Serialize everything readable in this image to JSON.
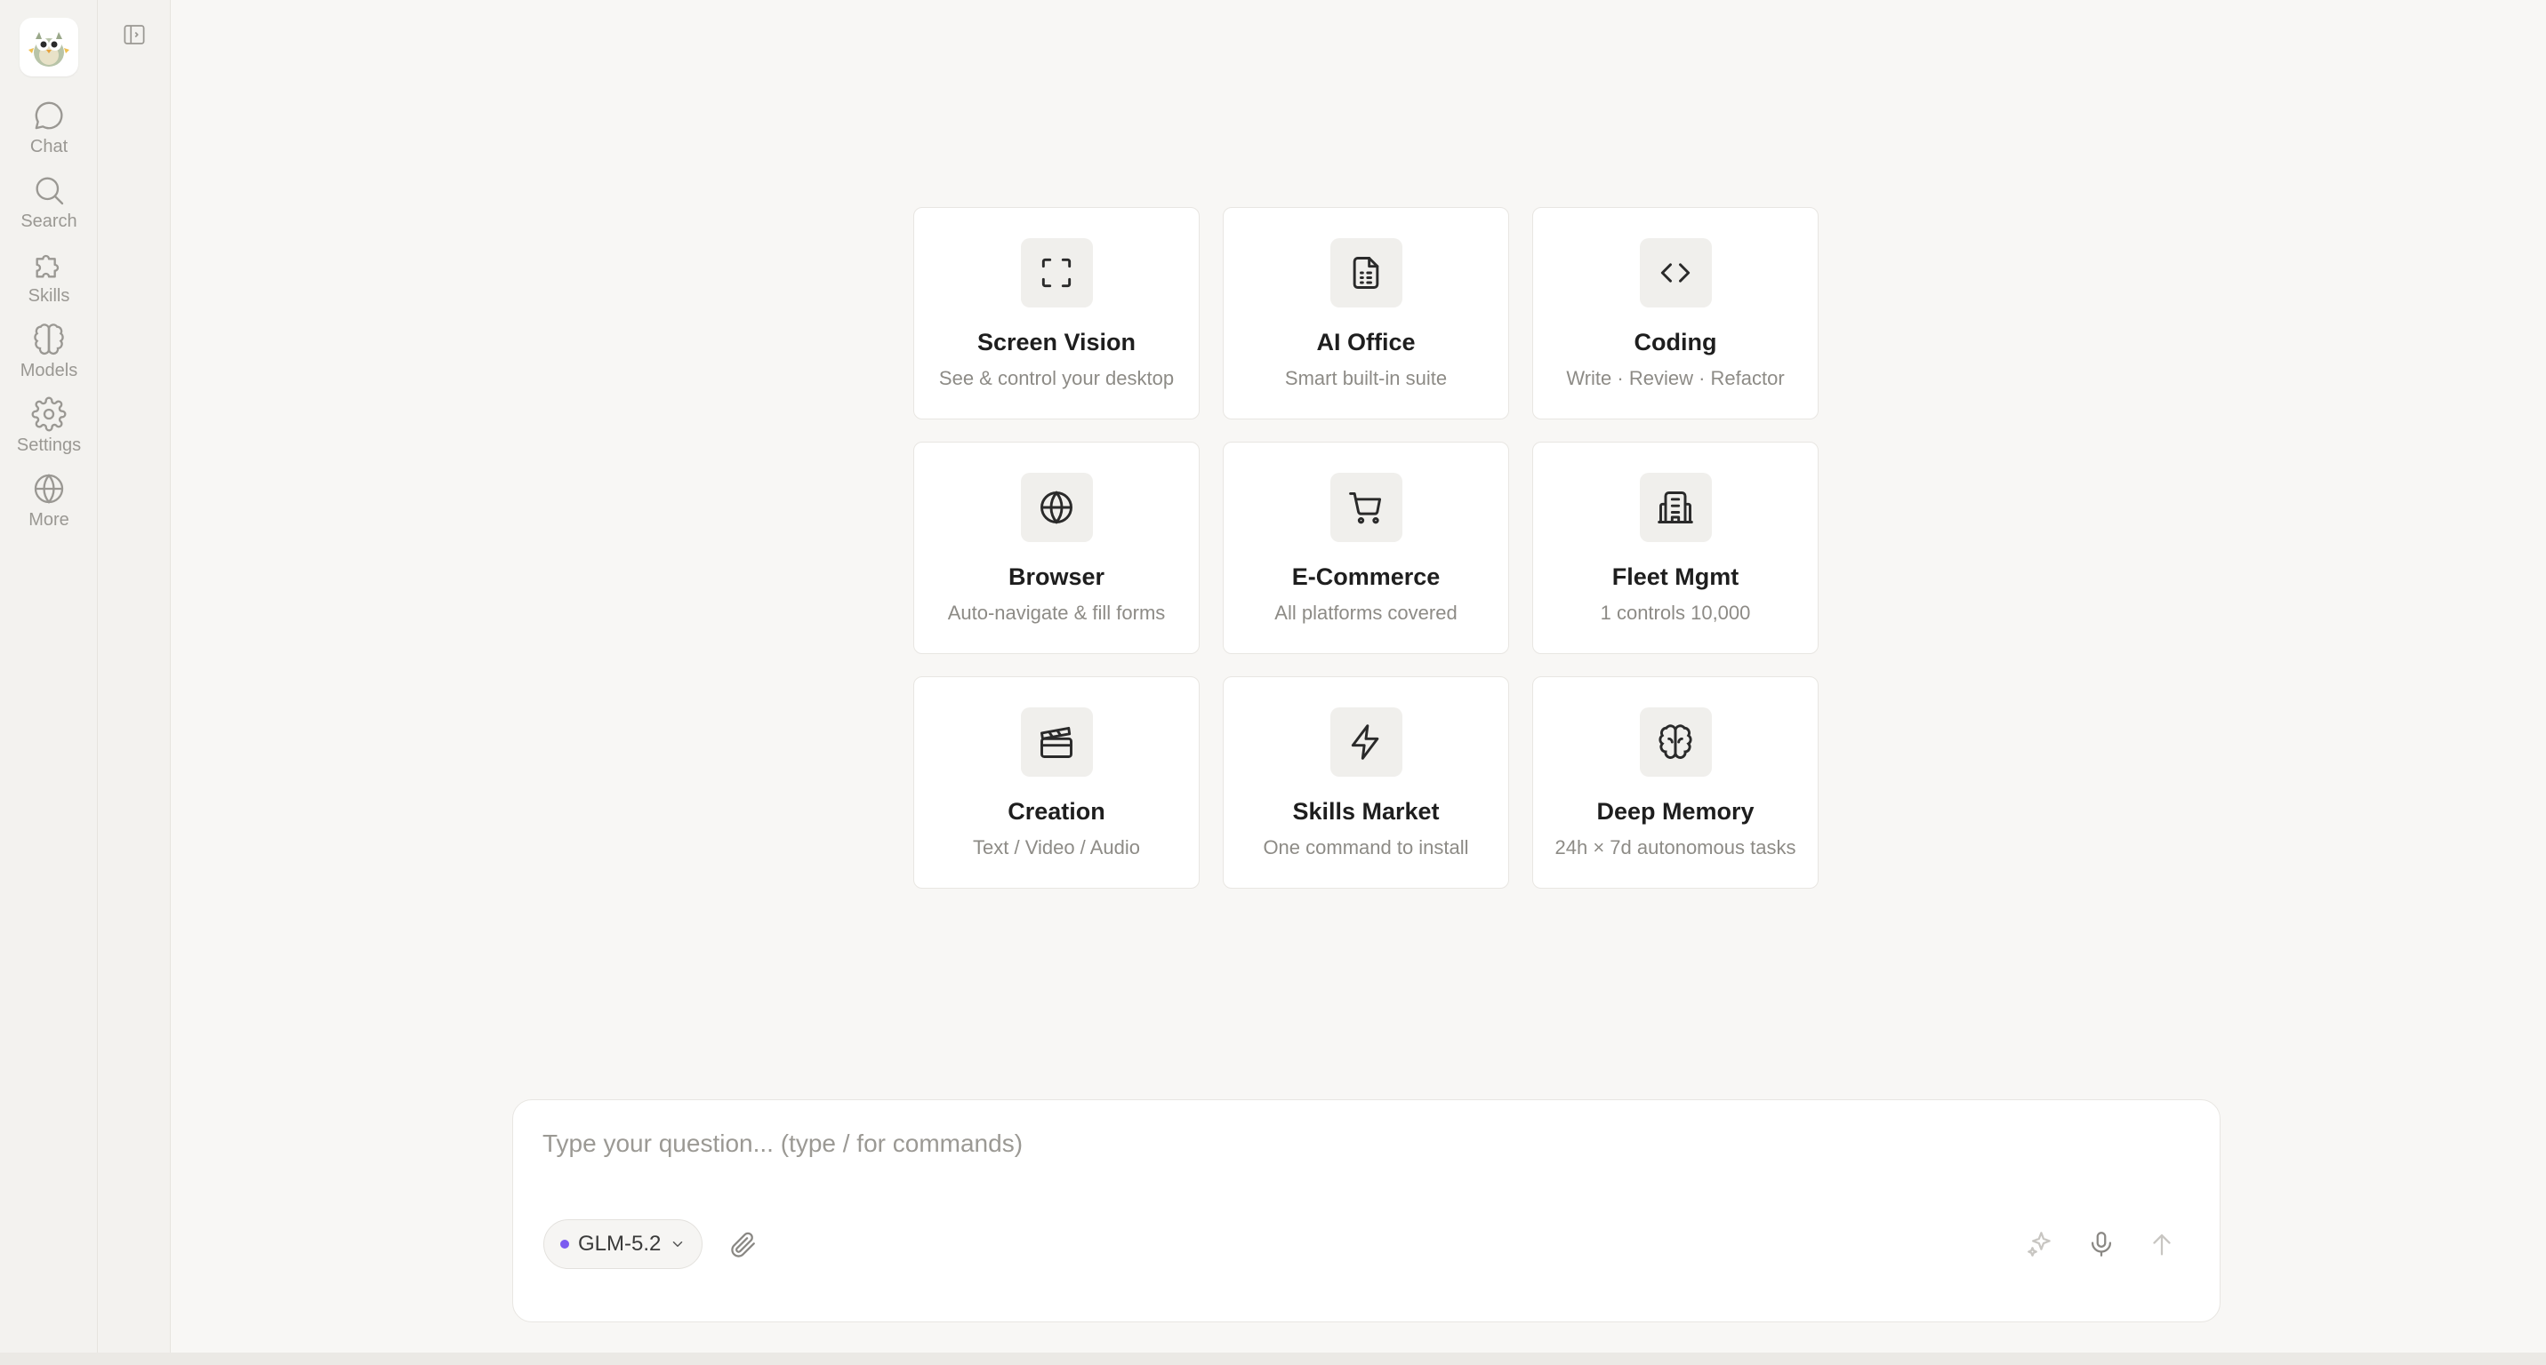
{
  "sidebar": {
    "items": [
      {
        "label": "Chat",
        "icon": "chat-bubble-icon"
      },
      {
        "label": "Search",
        "icon": "search-icon"
      },
      {
        "label": "Skills",
        "icon": "puzzle-icon"
      },
      {
        "label": "Models",
        "icon": "brain-icon"
      },
      {
        "label": "Settings",
        "icon": "gear-icon"
      },
      {
        "label": "More",
        "icon": "globe-icon"
      }
    ]
  },
  "cards": [
    {
      "title": "Screen Vision",
      "subtitle": "See & control your desktop",
      "icon": "scan-frame-icon"
    },
    {
      "title": "AI Office",
      "subtitle": "Smart built-in suite",
      "icon": "document-icon"
    },
    {
      "title": "Coding",
      "subtitle": "Write · Review · Refactor",
      "icon": "code-icon"
    },
    {
      "title": "Browser",
      "subtitle": "Auto-navigate & fill forms",
      "icon": "globe-icon"
    },
    {
      "title": "E-Commerce",
      "subtitle": "All platforms covered",
      "icon": "cart-icon"
    },
    {
      "title": "Fleet Mgmt",
      "subtitle": "1 controls 10,000",
      "icon": "building-icon"
    },
    {
      "title": "Creation",
      "subtitle": "Text / Video / Audio",
      "icon": "clapperboard-icon"
    },
    {
      "title": "Skills Market",
      "subtitle": "One command to install",
      "icon": "lightning-icon"
    },
    {
      "title": "Deep Memory",
      "subtitle": "24h × 7d autonomous tasks",
      "icon": "brain-icon"
    }
  ],
  "composer": {
    "placeholder": "Type your question... (type / for commands)",
    "value": "",
    "model": "GLM-5.2",
    "model_dot_color": "#7c5cf0"
  },
  "colors": {
    "background": "#f8f7f5",
    "sidebar": "#f3f2ef",
    "card": "#ffffff",
    "accent": "#7c5cf0"
  }
}
